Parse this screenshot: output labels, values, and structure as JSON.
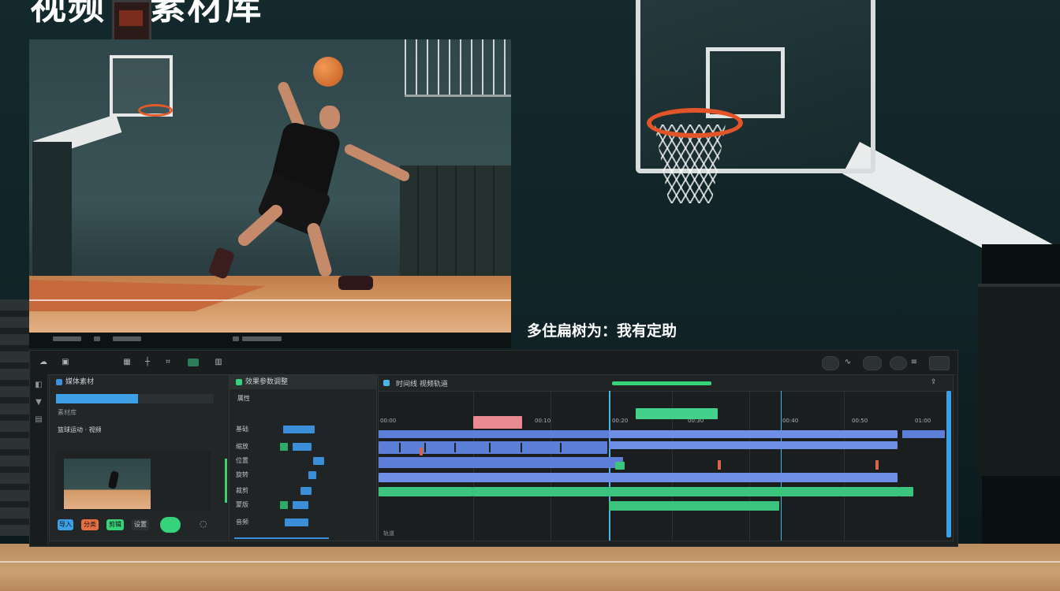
{
  "overlay": {
    "title": "视频 · 素材库",
    "caption": "多住扁树为：我有定助"
  },
  "toolbar": {
    "left_icons": [
      "cloud-icon",
      "file-icon"
    ],
    "center_icons": [
      "grid-icon",
      "split-icon",
      "crop-icon",
      "badge-icon",
      "text-icon"
    ],
    "right_icons": [
      "record-icon",
      "wave-icon",
      "minus-icon",
      "circle-icon",
      "list-icon",
      "bar-icon"
    ]
  },
  "media_panel": {
    "header": "媒体素材",
    "bar_fill_percent": 52,
    "sub_label": "素材库",
    "item_label": "篮球运动 · 视频",
    "buttons": [
      "导入",
      "分类",
      "剪辑",
      "设置"
    ]
  },
  "props_panel": {
    "header": "效果参数调整",
    "section": "属性",
    "rows": [
      "基础",
      "缩放",
      "位置",
      "旋转",
      "裁剪",
      "蒙版",
      "音频"
    ]
  },
  "timeline": {
    "header": "时间线 视频轨道",
    "track_labels": [
      "00:00",
      "00:10",
      "00:20",
      "00:30",
      "00:40",
      "00:50",
      "01:00"
    ],
    "bottom_mark": "轨道"
  },
  "colors": {
    "accent_blue": "#3da0e6",
    "accent_green": "#37d37b",
    "clip_blue": "#5d7fd8",
    "clip_pink": "#e88a8f",
    "clip_red": "#d9644a"
  }
}
